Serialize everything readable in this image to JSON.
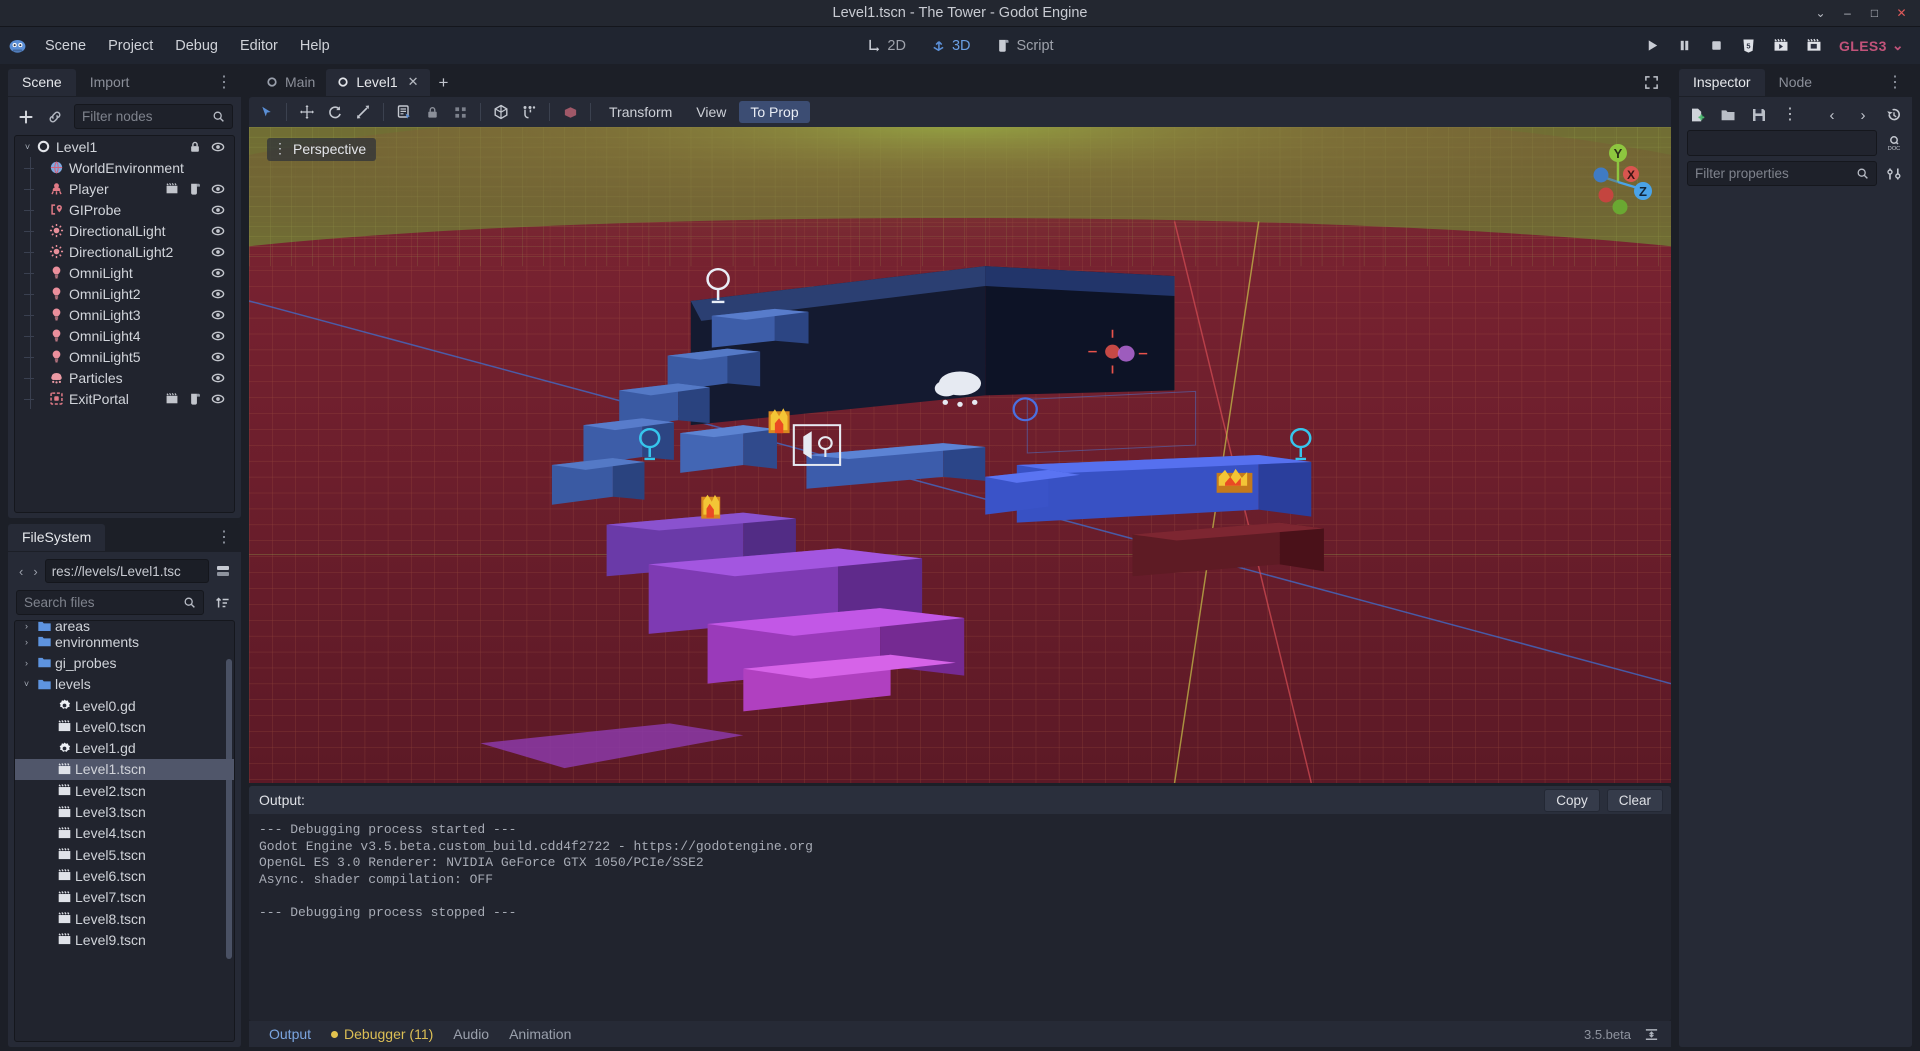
{
  "window": {
    "title": "Level1.tscn - The Tower - Godot Engine",
    "minimize": "–",
    "maximize": "□",
    "close": "✕",
    "collapse": "⌄"
  },
  "menubar": {
    "logo_icon": "godot-logo-icon",
    "items": [
      {
        "label": "Scene",
        "name": "menu-scene"
      },
      {
        "label": "Project",
        "name": "menu-project"
      },
      {
        "label": "Debug",
        "name": "menu-debug"
      },
      {
        "label": "Editor",
        "name": "menu-editor"
      },
      {
        "label": "Help",
        "name": "menu-help"
      }
    ],
    "main_screens": [
      {
        "label": "2D",
        "icon": "2d-icon",
        "active": false
      },
      {
        "label": "3D",
        "icon": "3d-icon",
        "active": true
      },
      {
        "label": "Script",
        "icon": "script-icon",
        "active": false
      }
    ],
    "play_controls": [
      {
        "name": "play-button",
        "icon": "play-icon"
      },
      {
        "name": "pause-button",
        "icon": "pause-icon"
      },
      {
        "name": "stop-button",
        "icon": "stop-icon"
      },
      {
        "name": "play-custom-scene-button",
        "icon": "html5-icon"
      },
      {
        "name": "play-scene-button",
        "icon": "play-scene-icon"
      },
      {
        "name": "play-current-scene-button",
        "icon": "movie-icon"
      }
    ],
    "renderer": {
      "label": "GLES3",
      "chevron": "⌄"
    }
  },
  "scene_dock": {
    "tabs": [
      {
        "label": "Scene",
        "active": true
      },
      {
        "label": "Import",
        "active": false
      }
    ],
    "menu_icon": "vertical-dots-icon",
    "add_icon": "add-node-icon",
    "link_icon": "instance-child-scene-icon",
    "filter": {
      "placeholder": "Filter nodes",
      "value": "",
      "icon": "search-icon"
    },
    "nodes": [
      {
        "label": "Level1",
        "icon": "spatial-icon",
        "depth": 0,
        "arrow": "˅",
        "badges": [
          "lock-icon",
          "visibility-icon"
        ],
        "selected": false
      },
      {
        "label": "WorldEnvironment",
        "icon": "world-environment-icon",
        "depth": 1,
        "arrow": "",
        "badges": [],
        "selected": false
      },
      {
        "label": "Player",
        "icon": "player-icon",
        "depth": 1,
        "arrow": "",
        "badges": [
          "scene-icon",
          "script-icon",
          "visibility-icon"
        ],
        "selected": false
      },
      {
        "label": "GIProbe",
        "icon": "giprobe-icon",
        "depth": 1,
        "arrow": "",
        "badges": [
          "visibility-icon"
        ],
        "selected": false
      },
      {
        "label": "DirectionalLight",
        "icon": "directional-light-icon",
        "depth": 1,
        "arrow": "",
        "badges": [
          "visibility-icon"
        ],
        "selected": false
      },
      {
        "label": "DirectionalLight2",
        "icon": "directional-light-icon",
        "depth": 1,
        "arrow": "",
        "badges": [
          "visibility-icon"
        ],
        "selected": false
      },
      {
        "label": "OmniLight",
        "icon": "omni-light-icon",
        "depth": 1,
        "arrow": "",
        "badges": [
          "visibility-icon"
        ],
        "selected": false
      },
      {
        "label": "OmniLight2",
        "icon": "omni-light-icon",
        "depth": 1,
        "arrow": "",
        "badges": [
          "visibility-icon"
        ],
        "selected": false
      },
      {
        "label": "OmniLight3",
        "icon": "omni-light-icon",
        "depth": 1,
        "arrow": "",
        "badges": [
          "visibility-icon"
        ],
        "selected": false
      },
      {
        "label": "OmniLight4",
        "icon": "omni-light-icon",
        "depth": 1,
        "arrow": "",
        "badges": [
          "visibility-icon"
        ],
        "selected": false
      },
      {
        "label": "OmniLight5",
        "icon": "omni-light-icon",
        "depth": 1,
        "arrow": "",
        "badges": [
          "visibility-icon"
        ],
        "selected": false
      },
      {
        "label": "Particles",
        "icon": "particles-icon",
        "depth": 1,
        "arrow": "",
        "badges": [
          "visibility-icon"
        ],
        "selected": false
      },
      {
        "label": "ExitPortal",
        "icon": "area-icon",
        "depth": 1,
        "arrow": "",
        "badges": [
          "scene-icon",
          "script-icon",
          "visibility-icon"
        ],
        "selected": false
      }
    ]
  },
  "filesystem_dock": {
    "tab_label": "FileSystem",
    "menu_icon": "vertical-dots-icon",
    "back_arrow": "‹",
    "forward_arrow": "›",
    "path": "res://levels/Level1.tsc",
    "split_icon": "split-mode-icon",
    "search": {
      "placeholder": "Search files",
      "value": "",
      "icon": "search-icon"
    },
    "sort_icon": "sort-icon",
    "entries": [
      {
        "label": "areas",
        "type": "folder",
        "depth": 1,
        "arrow": "›",
        "selected": false,
        "clipped": true
      },
      {
        "label": "environments",
        "type": "folder",
        "depth": 1,
        "arrow": "›",
        "selected": false
      },
      {
        "label": "gi_probes",
        "type": "folder",
        "depth": 1,
        "arrow": "›",
        "selected": false
      },
      {
        "label": "levels",
        "type": "folder",
        "depth": 1,
        "arrow": "˅",
        "selected": false
      },
      {
        "label": "Level0.gd",
        "type": "script",
        "depth": 2,
        "arrow": "",
        "selected": false
      },
      {
        "label": "Level0.tscn",
        "type": "scene",
        "depth": 2,
        "arrow": "",
        "selected": false
      },
      {
        "label": "Level1.gd",
        "type": "script",
        "depth": 2,
        "arrow": "",
        "selected": false
      },
      {
        "label": "Level1.tscn",
        "type": "scene",
        "depth": 2,
        "arrow": "",
        "selected": true
      },
      {
        "label": "Level2.tscn",
        "type": "scene",
        "depth": 2,
        "arrow": "",
        "selected": false
      },
      {
        "label": "Level3.tscn",
        "type": "scene",
        "depth": 2,
        "arrow": "",
        "selected": false
      },
      {
        "label": "Level4.tscn",
        "type": "scene",
        "depth": 2,
        "arrow": "",
        "selected": false
      },
      {
        "label": "Level5.tscn",
        "type": "scene",
        "depth": 2,
        "arrow": "",
        "selected": false
      },
      {
        "label": "Level6.tscn",
        "type": "scene",
        "depth": 2,
        "arrow": "",
        "selected": false
      },
      {
        "label": "Level7.tscn",
        "type": "scene",
        "depth": 2,
        "arrow": "",
        "selected": false
      },
      {
        "label": "Level8.tscn",
        "type": "scene",
        "depth": 2,
        "arrow": "",
        "selected": false
      },
      {
        "label": "Level9.tscn",
        "type": "scene",
        "depth": 2,
        "arrow": "",
        "selected": false
      }
    ]
  },
  "scene_tabs": {
    "tabs": [
      {
        "label": "Main",
        "active": false,
        "closable": false
      },
      {
        "label": "Level1",
        "active": true,
        "closable": true
      }
    ],
    "add_label": "+",
    "expand_icon": "fullscreen-icon"
  },
  "viewport_toolbar": {
    "tools": [
      {
        "name": "select-mode-button",
        "icon": "cursor-icon",
        "active": true
      },
      {
        "name": "move-mode-button",
        "icon": "move-icon",
        "active": false
      },
      {
        "name": "rotate-mode-button",
        "icon": "rotate-icon",
        "active": false
      },
      {
        "name": "scale-mode-button",
        "icon": "scale-icon",
        "active": false
      },
      {
        "name": "list-select-button",
        "icon": "list-select-icon",
        "active": false
      },
      {
        "name": "lock-button",
        "icon": "lock-icon",
        "active": false
      },
      {
        "name": "group-button",
        "icon": "group-icon",
        "active": false
      },
      {
        "name": "local-space-button",
        "icon": "local-space-icon",
        "active": false
      },
      {
        "name": "snap-button",
        "icon": "snap-icon",
        "active": false
      },
      {
        "name": "camera-override-button",
        "icon": "camera-icon",
        "active": false
      }
    ],
    "menus": [
      {
        "label": "Transform",
        "highlighted": false
      },
      {
        "label": "View",
        "highlighted": false
      },
      {
        "label": "To Prop",
        "highlighted": true
      }
    ]
  },
  "viewport": {
    "perspective_label": "Perspective",
    "menu_icon": "vertical-dots-icon",
    "gizmo": {
      "x": "X",
      "y": "Y",
      "z": "Z"
    }
  },
  "output_panel": {
    "header": "Output:",
    "copy_label": "Copy",
    "clear_label": "Clear",
    "lines": "--- Debugging process started ---\nGodot Engine v3.5.beta.custom_build.cdd4f2722 - https://godotengine.org\nOpenGL ES 3.0 Renderer: NVIDIA GeForce GTX 1050/PCIe/SSE2\nAsync. shader compilation: OFF\n\n--- Debugging process stopped ---"
  },
  "bottom_bar": {
    "tabs": [
      {
        "label": "Output",
        "active": true,
        "badge": "",
        "warn": false
      },
      {
        "label": "Debugger (11)",
        "active": false,
        "badge": "dot",
        "warn": true
      },
      {
        "label": "Audio",
        "active": false,
        "badge": "",
        "warn": false
      },
      {
        "label": "Animation",
        "active": false,
        "badge": "",
        "warn": false
      }
    ],
    "version": "3.5.beta",
    "layout_icon": "expand-bottom-icon"
  },
  "inspector": {
    "tabs": [
      {
        "label": "Inspector",
        "active": true
      },
      {
        "label": "Node",
        "active": false
      }
    ],
    "menu_icon": "vertical-dots-icon",
    "tools": [
      {
        "name": "new-resource-button",
        "icon": "new-resource-icon"
      },
      {
        "name": "load-resource-button",
        "icon": "folder-icon"
      },
      {
        "name": "save-resource-button",
        "icon": "save-icon"
      },
      {
        "name": "resource-menu-button",
        "icon": "vertical-dots-icon"
      }
    ],
    "history_back": "‹",
    "history_forward": "›",
    "history_icon": "history-icon",
    "doc_icon": "search-doc-icon",
    "object_field_value": "",
    "filter": {
      "placeholder": "Filter properties",
      "value": "",
      "icon": "search-icon"
    },
    "settings_icon": "tools-icon"
  },
  "colors": {
    "accent": "#6b9fe3",
    "bg_dark": "#1c1f27",
    "panel": "#262a36",
    "selection": "#50566a",
    "renderer": "#c2537a",
    "warning": "#dcbf55"
  }
}
